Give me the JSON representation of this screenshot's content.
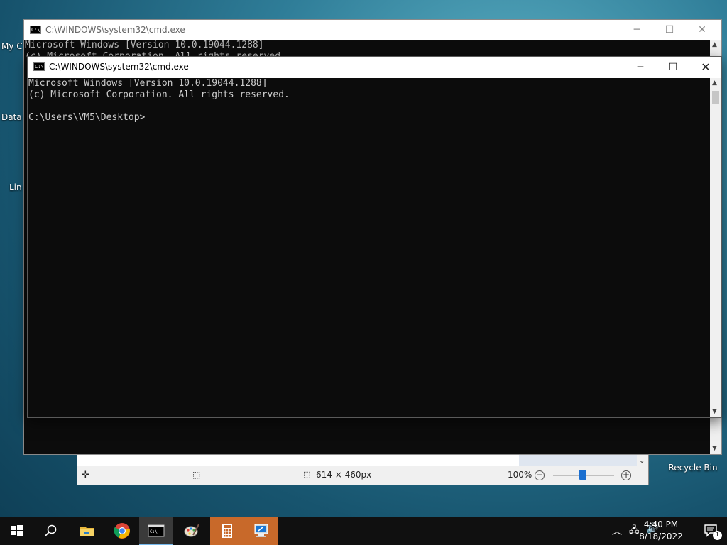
{
  "desktop": {
    "icons": [
      {
        "label": "Recycle Bin",
        "icon": "recycle-bin-icon"
      }
    ],
    "partial_labels": [
      "My C",
      "Data",
      "Lin"
    ]
  },
  "paint": {
    "status": {
      "move_icon": "move-icon",
      "selection_icon": "selection-size-icon",
      "image_size": "614 × 460px",
      "zoom": "100%"
    }
  },
  "cmd_back": {
    "title": "C:\\WINDOWS\\system32\\cmd.exe",
    "line1": "Microsoft Windows [Version 10.0.19044.1288]",
    "line2": "(c) Microsoft Corporation. All rights reserved."
  },
  "cmd_front": {
    "title": "C:\\WINDOWS\\system32\\cmd.exe",
    "minimize": "─",
    "maximize": "☐",
    "close": "✕",
    "line1": "Microsoft Windows [Version 10.0.19044.1288]",
    "line2": "(c) Microsoft Corporation. All rights reserved.",
    "line3": "",
    "prompt": "C:\\Users\\VM5\\Desktop>"
  },
  "taskbar": {
    "apps": [
      {
        "name": "start",
        "icon": "windows-logo-icon"
      },
      {
        "name": "search",
        "icon": "search-icon"
      },
      {
        "name": "file-explorer",
        "icon": "folder-icon"
      },
      {
        "name": "chrome",
        "icon": "chrome-icon"
      },
      {
        "name": "command-prompt",
        "icon": "cmd-icon",
        "active": true
      },
      {
        "name": "paint",
        "icon": "paint-icon"
      },
      {
        "name": "calculator",
        "icon": "calculator-icon"
      },
      {
        "name": "remote-desktop",
        "icon": "remote-desktop-icon"
      }
    ],
    "tray": {
      "time": "4:40 PM",
      "date": "8/18/2022",
      "notification_count": "1"
    }
  }
}
